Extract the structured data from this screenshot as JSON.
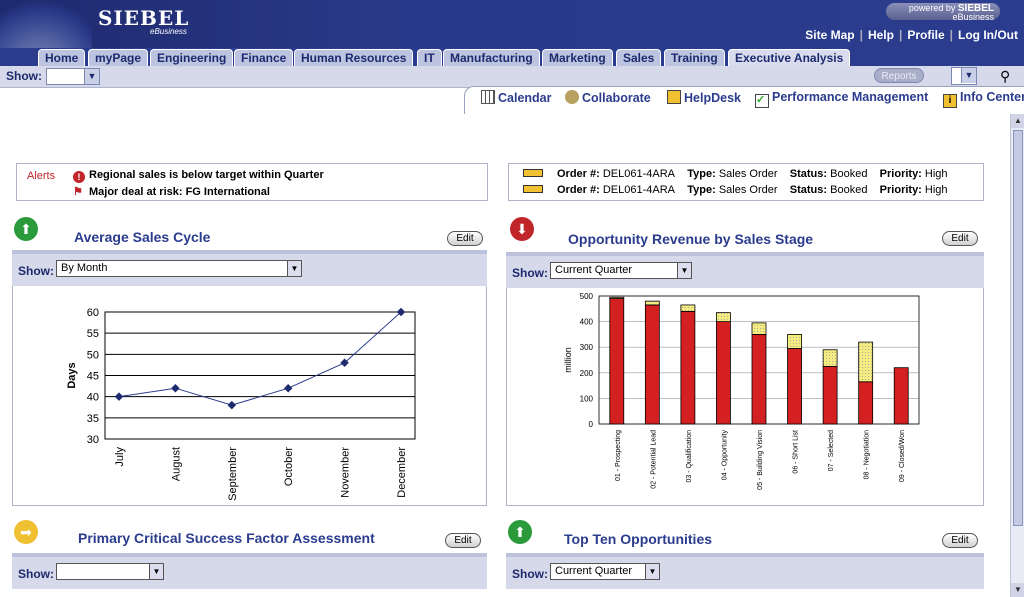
{
  "header": {
    "logo": "SIEBEL",
    "logo_sub": "eBusiness",
    "powered_by": "powered by",
    "powered_brand": "SIEBEL",
    "powered_sub": "eBusiness",
    "links": [
      "Site Map",
      "Help",
      "Profile",
      "Log In/Out"
    ]
  },
  "tabs": [
    {
      "label": "Home"
    },
    {
      "label": "myPage"
    },
    {
      "label": "Engineering"
    },
    {
      "label": "Finance"
    },
    {
      "label": "Human Resources"
    },
    {
      "label": "IT"
    },
    {
      "label": "Manufacturing"
    },
    {
      "label": "Marketing"
    },
    {
      "label": "Sales"
    },
    {
      "label": "Training"
    },
    {
      "label": "Executive Analysis",
      "active": true
    }
  ],
  "showbar": {
    "label": "Show:",
    "reports": "Reports"
  },
  "quicklinks": [
    {
      "label": "Calendar",
      "icon": "calendar-icon"
    },
    {
      "label": "Collaborate",
      "icon": "people-icon"
    },
    {
      "label": "HelpDesk",
      "icon": "monitor-icon"
    },
    {
      "label": "Performance Management",
      "icon": "checklist-icon"
    },
    {
      "label": "Info Center",
      "icon": "info-icon"
    }
  ],
  "alerts": {
    "label": "Alerts",
    "items": [
      {
        "text": "Regional sales is below target within Quarter",
        "icon": "exclamation-icon"
      },
      {
        "text": "Major deal at risk: FG International",
        "icon": "flag-icon"
      }
    ]
  },
  "orders": [
    {
      "order_label": "Order #:",
      "order": "DEL061-4ARA",
      "type_label": "Type:",
      "type": "Sales Order",
      "status_label": "Status:",
      "status": "Booked",
      "priority_label": "Priority:",
      "priority": "High"
    },
    {
      "order_label": "Order #:",
      "order": "DEL061-4ARA",
      "type_label": "Type:",
      "type": "Sales Order",
      "status_label": "Status:",
      "status": "Booked",
      "priority_label": "Priority:",
      "priority": "High"
    }
  ],
  "portlets": {
    "avg_sales": {
      "title": "Average Sales Cycle",
      "edit": "Edit",
      "show_label": "Show:",
      "show_value": "By Month"
    },
    "opp_revenue": {
      "title": "Opportunity Revenue by Sales Stage",
      "edit": "Edit",
      "show_label": "Show:",
      "show_value": "Current Quarter"
    },
    "csf": {
      "title": "Primary Critical Success Factor Assessment",
      "edit": "Edit",
      "show_label": "Show:",
      "show_value": ""
    },
    "top_ten": {
      "title": "Top Ten Opportunities",
      "edit": "Edit",
      "show_label": "Show:",
      "show_value": "Current Quarter"
    }
  },
  "colors": {
    "brand": "#2b3c8e",
    "bar_red": "#d42020",
    "bar_yellow": "#f0e070"
  },
  "chart_data": [
    {
      "type": "line",
      "categories": [
        "July",
        "August",
        "September",
        "October",
        "November",
        "December"
      ],
      "values": [
        40,
        42,
        38,
        42,
        48,
        60
      ],
      "ylabel": "Days",
      "ylim": [
        30,
        60
      ],
      "yticks": [
        30,
        35,
        40,
        45,
        50,
        55,
        60
      ],
      "grid": true
    },
    {
      "type": "bar",
      "categories": [
        "01 - Prospecting",
        "02 - Potential Lead",
        "03 - Qualification",
        "04 - Opportunity",
        "05 - Building Vision",
        "06 - Short List",
        "07 - Selected",
        "08 - Negotiation",
        "09 - Closed/Won"
      ],
      "series": [
        {
          "values": [
            490,
            465,
            440,
            400,
            350,
            295,
            225,
            165,
            220
          ]
        },
        {
          "values": [
            5,
            15,
            25,
            35,
            45,
            55,
            65,
            155,
            0
          ]
        }
      ],
      "ylabel": "million",
      "ylim": [
        0,
        500
      ],
      "yticks": [
        0,
        100,
        200,
        300,
        400,
        500
      ],
      "stacked": true
    }
  ]
}
